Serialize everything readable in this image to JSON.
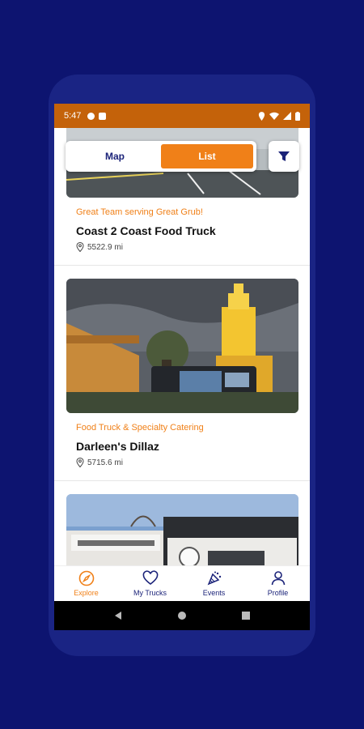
{
  "status_bar": {
    "time": "5:47"
  },
  "view_toggle": {
    "options": [
      "Map",
      "List"
    ],
    "selected": "List"
  },
  "cards": [
    {
      "tag": "Great Team serving Great Grub!",
      "name": "Coast 2 Coast Food Truck",
      "distance": "5522.9 mi"
    },
    {
      "tag": "Food Truck & Specialty Catering",
      "name": "Darleen's Dillaz",
      "distance": "5715.6 mi"
    },
    {
      "tag": "",
      "name": "",
      "distance": ""
    }
  ],
  "bottom_nav": [
    {
      "label": "Explore",
      "icon": "compass-icon",
      "active": true
    },
    {
      "label": "My Trucks",
      "icon": "heart-icon",
      "active": false
    },
    {
      "label": "Events",
      "icon": "events-icon",
      "active": false
    },
    {
      "label": "Profile",
      "icon": "person-icon",
      "active": false
    }
  ],
  "colors": {
    "accent": "#f08018",
    "navy": "#1b2379",
    "background": "#0d1470",
    "status_bar": "#c4620a"
  }
}
